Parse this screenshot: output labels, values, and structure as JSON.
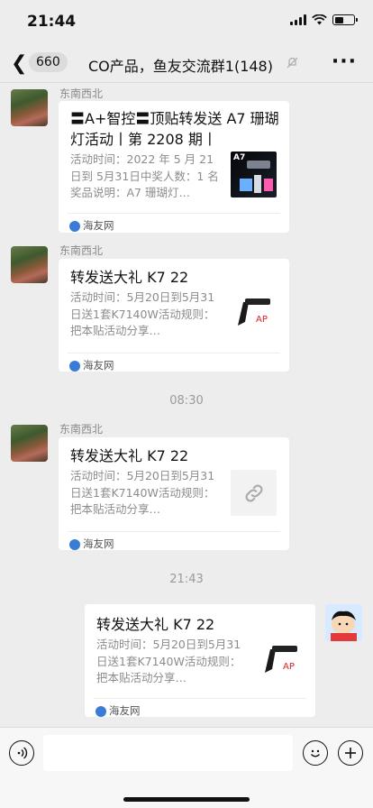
{
  "status": {
    "time": "21:44"
  },
  "header": {
    "unread_count": "660",
    "title": "CO产品，鱼友交流群1(148)"
  },
  "messages": [
    {
      "sender": "东南西北",
      "title": "〓A+智控〓顶贴转发送 A7 珊瑚灯活动丨第 2208 期丨",
      "desc": "活动时间：2022 年 5 月 21 日到 5月31日中奖人数：1 名奖品说明：A7 珊瑚灯…",
      "source": "海友网",
      "thumb_text": "A7"
    },
    {
      "sender": "东南西北",
      "title": "转发送大礼 K7 22",
      "desc": "活动时间：5月20日到5月31日送1套K7140W活动规则：把本贴活动分享…",
      "source": "海友网"
    },
    {
      "sender": "东南西北",
      "title": "转发送大礼 K7 22",
      "desc": "活动时间：5月20日到5月31日送1套K7140W活动规则：把本贴活动分享…",
      "source": "海友网"
    },
    {
      "title": "转发送大礼 K7 22",
      "desc": "活动时间：5月20日到5月31日送1套K7140W活动规则：把本贴活动分享…",
      "source": "海友网"
    }
  ],
  "time_separators": [
    "08:30",
    "21:43"
  ],
  "colors": {
    "background": "#ededed",
    "card": "#ffffff",
    "muted": "#8c8c8c"
  }
}
